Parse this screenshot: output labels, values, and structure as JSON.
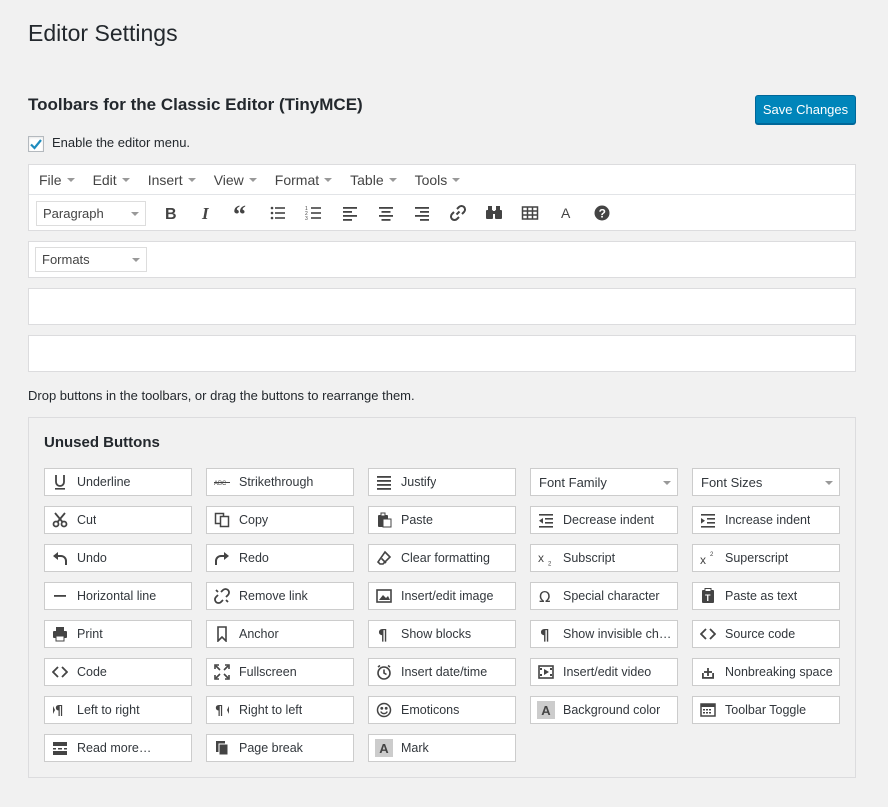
{
  "page": {
    "title": "Editor Settings",
    "section_title": "Toolbars for the Classic Editor (TinyMCE)",
    "save_label": "Save Changes",
    "enable_menu_label": "Enable the editor menu.",
    "enable_menu_checked": true,
    "hint": "Drop buttons in the toolbars, or drag the buttons to rearrange them."
  },
  "menubar": [
    "File",
    "Edit",
    "Insert",
    "View",
    "Format",
    "Table",
    "Tools"
  ],
  "toolbar1": {
    "block_select": "Paragraph",
    "icons": [
      "bold-icon",
      "italic-icon",
      "blockquote-icon",
      "bullet-list-icon",
      "numbered-list-icon",
      "align-left-icon",
      "align-center-icon",
      "align-right-icon",
      "link-icon",
      "find-icon",
      "table-icon",
      "text-color-icon",
      "help-icon"
    ]
  },
  "toolbar2": {
    "formats_select": "Formats"
  },
  "unused": {
    "title": "Unused Buttons",
    "buttons": [
      {
        "label": "Underline",
        "icon": "underline-icon"
      },
      {
        "label": "Strikethrough",
        "icon": "strikethrough-icon"
      },
      {
        "label": "Justify",
        "icon": "justify-icon"
      },
      {
        "label": "Font Family",
        "icon": "",
        "select": true
      },
      {
        "label": "Font Sizes",
        "icon": "",
        "select": true
      },
      {
        "label": "Cut",
        "icon": "cut-icon"
      },
      {
        "label": "Copy",
        "icon": "copy-icon"
      },
      {
        "label": "Paste",
        "icon": "paste-icon"
      },
      {
        "label": "Decrease indent",
        "icon": "outdent-icon"
      },
      {
        "label": "Increase indent",
        "icon": "indent-icon"
      },
      {
        "label": "Undo",
        "icon": "undo-icon"
      },
      {
        "label": "Redo",
        "icon": "redo-icon"
      },
      {
        "label": "Clear formatting",
        "icon": "eraser-icon"
      },
      {
        "label": "Subscript",
        "icon": "subscript-icon"
      },
      {
        "label": "Superscript",
        "icon": "superscript-icon"
      },
      {
        "label": "Horizontal line",
        "icon": "hr-icon"
      },
      {
        "label": "Remove link",
        "icon": "unlink-icon"
      },
      {
        "label": "Insert/edit image",
        "icon": "image-icon"
      },
      {
        "label": "Special character",
        "icon": "omega-icon"
      },
      {
        "label": "Paste as text",
        "icon": "paste-text-icon"
      },
      {
        "label": "Print",
        "icon": "print-icon"
      },
      {
        "label": "Anchor",
        "icon": "bookmark-icon"
      },
      {
        "label": "Show blocks",
        "icon": "pilcrow-icon"
      },
      {
        "label": "Show invisible chara…",
        "icon": "pilcrow-icon"
      },
      {
        "label": "Source code",
        "icon": "code-icon"
      },
      {
        "label": "Code",
        "icon": "code-icon"
      },
      {
        "label": "Fullscreen",
        "icon": "fullscreen-icon"
      },
      {
        "label": "Insert date/time",
        "icon": "clock-icon"
      },
      {
        "label": "Insert/edit video",
        "icon": "video-icon"
      },
      {
        "label": "Nonbreaking space",
        "icon": "nbsp-icon"
      },
      {
        "label": "Left to right",
        "icon": "ltr-icon"
      },
      {
        "label": "Right to left",
        "icon": "rtl-icon"
      },
      {
        "label": "Emoticons",
        "icon": "emoticons-icon"
      },
      {
        "label": "Background color",
        "icon": "bgcolor-icon"
      },
      {
        "label": "Toolbar Toggle",
        "icon": "toolbar-toggle-icon"
      },
      {
        "label": "Read more…",
        "icon": "read-more-icon"
      },
      {
        "label": "Page break",
        "icon": "page-break-icon"
      },
      {
        "label": "Mark",
        "icon": "mark-icon"
      }
    ]
  },
  "colors": {
    "accent": "#0085ba",
    "background": "#f1f1f1",
    "checkmark": "#1e8cbe"
  }
}
